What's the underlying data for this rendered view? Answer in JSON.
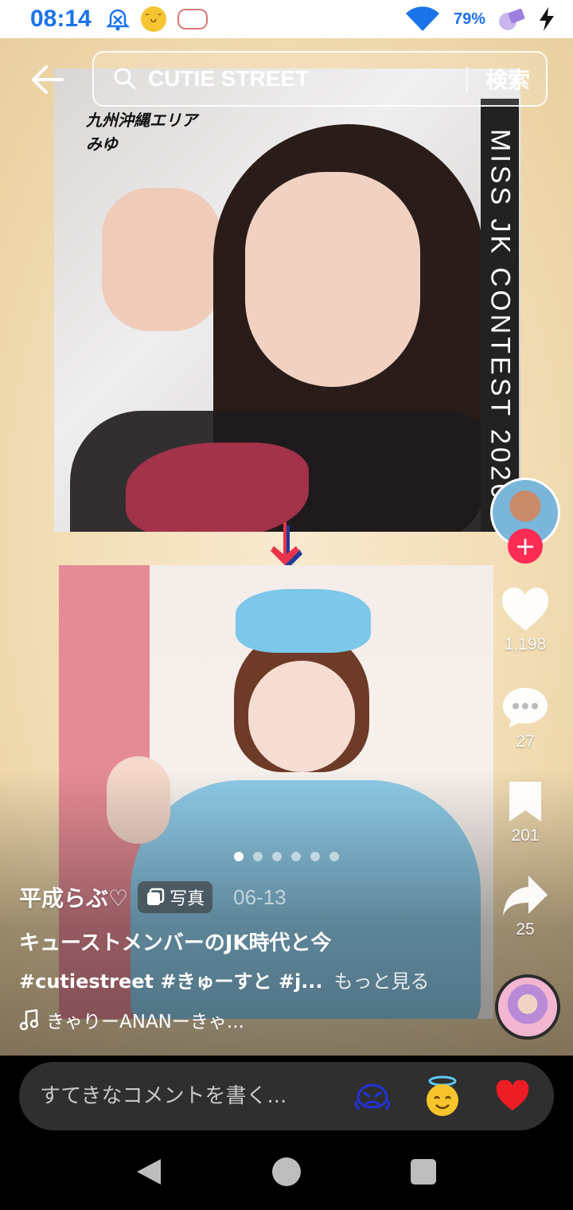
{
  "status_bar": {
    "time": "08:14",
    "battery_percent": "79%",
    "icons": [
      "alarm-off-icon",
      "emoji-face-icon",
      "cat-sticker-icon",
      "wifi-icon",
      "battery-icon",
      "charging-icon"
    ]
  },
  "search": {
    "query": "CUTIE STREET",
    "button_label": "検索"
  },
  "post": {
    "images": {
      "top_caption_lines": [
        "九州沖縄エリア",
        "みゆ"
      ],
      "top_banner_text": "MISS JK CONTEST 2020"
    },
    "carousel": {
      "total": 6,
      "active_index": 0
    },
    "author": "平成らぶ♡",
    "badge_label": "写真",
    "date": "06-13",
    "title": "キューストメンバーのJK時代と今",
    "hashtags": "#cutiestreet #きゅーすと #j...",
    "more_label": "もっと見る",
    "music": "きゃりーANANーきゃ..."
  },
  "actions": {
    "likes": "1,198",
    "comments": "27",
    "saves": "201",
    "shares": "25"
  },
  "comment_bar": {
    "placeholder": "すてきなコメントを書く...",
    "quick_emojis": [
      "crying-face-icon",
      "halo-face-icon",
      "heart-icon"
    ]
  },
  "colors": {
    "accent_red": "#fe2c55",
    "status_blue": "#1a73e8",
    "comment_bar_bg": "#2f2f2f",
    "feed_bg": "#f1dcb4"
  }
}
